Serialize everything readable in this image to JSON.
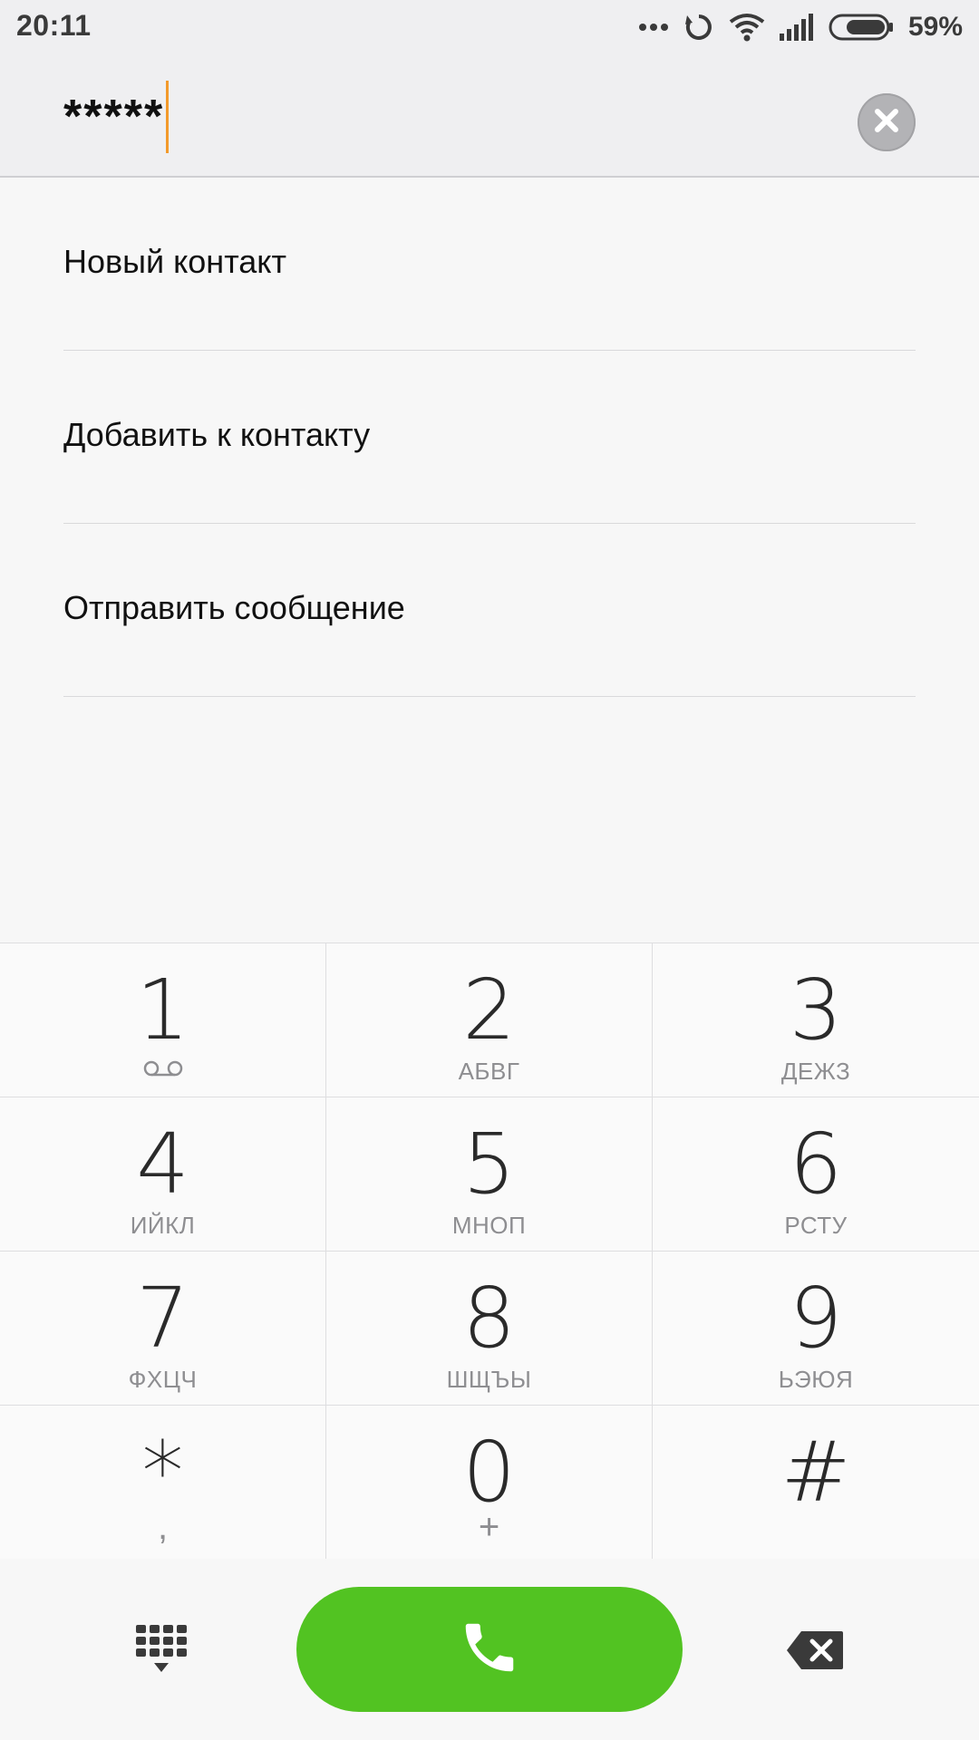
{
  "status_bar": {
    "time": "20:11",
    "battery_percent": "59%",
    "icons": [
      "more-dots-icon",
      "sync-icon",
      "wifi-icon",
      "signal-icon",
      "battery-icon"
    ]
  },
  "entry": {
    "number": "*****",
    "clear_icon": "close-icon"
  },
  "actions": [
    {
      "label": "Новый контакт"
    },
    {
      "label": "Добавить к контакту"
    },
    {
      "label": "Отправить сообщение"
    }
  ],
  "keypad": {
    "keys": [
      {
        "digit": "1",
        "letters": "",
        "sub_icon": "voicemail-icon"
      },
      {
        "digit": "2",
        "letters": "АБВГ"
      },
      {
        "digit": "3",
        "letters": "ДЕЖЗ"
      },
      {
        "digit": "4",
        "letters": "ИЙКЛ"
      },
      {
        "digit": "5",
        "letters": "МНОП"
      },
      {
        "digit": "6",
        "letters": "РСТУ"
      },
      {
        "digit": "7",
        "letters": "ФХЦЧ"
      },
      {
        "digit": "8",
        "letters": "ШЩЪЫ"
      },
      {
        "digit": "9",
        "letters": "ЬЭЮЯ"
      },
      {
        "digit": "*",
        "letters": ","
      },
      {
        "digit": "0",
        "letters": "+"
      },
      {
        "digit": "#",
        "letters": ""
      }
    ]
  },
  "bottom_bar": {
    "dialpad_icon": "dialpad-icon",
    "call_icon": "phone-icon",
    "backspace_icon": "backspace-icon"
  },
  "colors": {
    "accent_cursor": "#f39a2b",
    "call_green": "#52c322",
    "clear_grey": "#b3b3b6"
  }
}
